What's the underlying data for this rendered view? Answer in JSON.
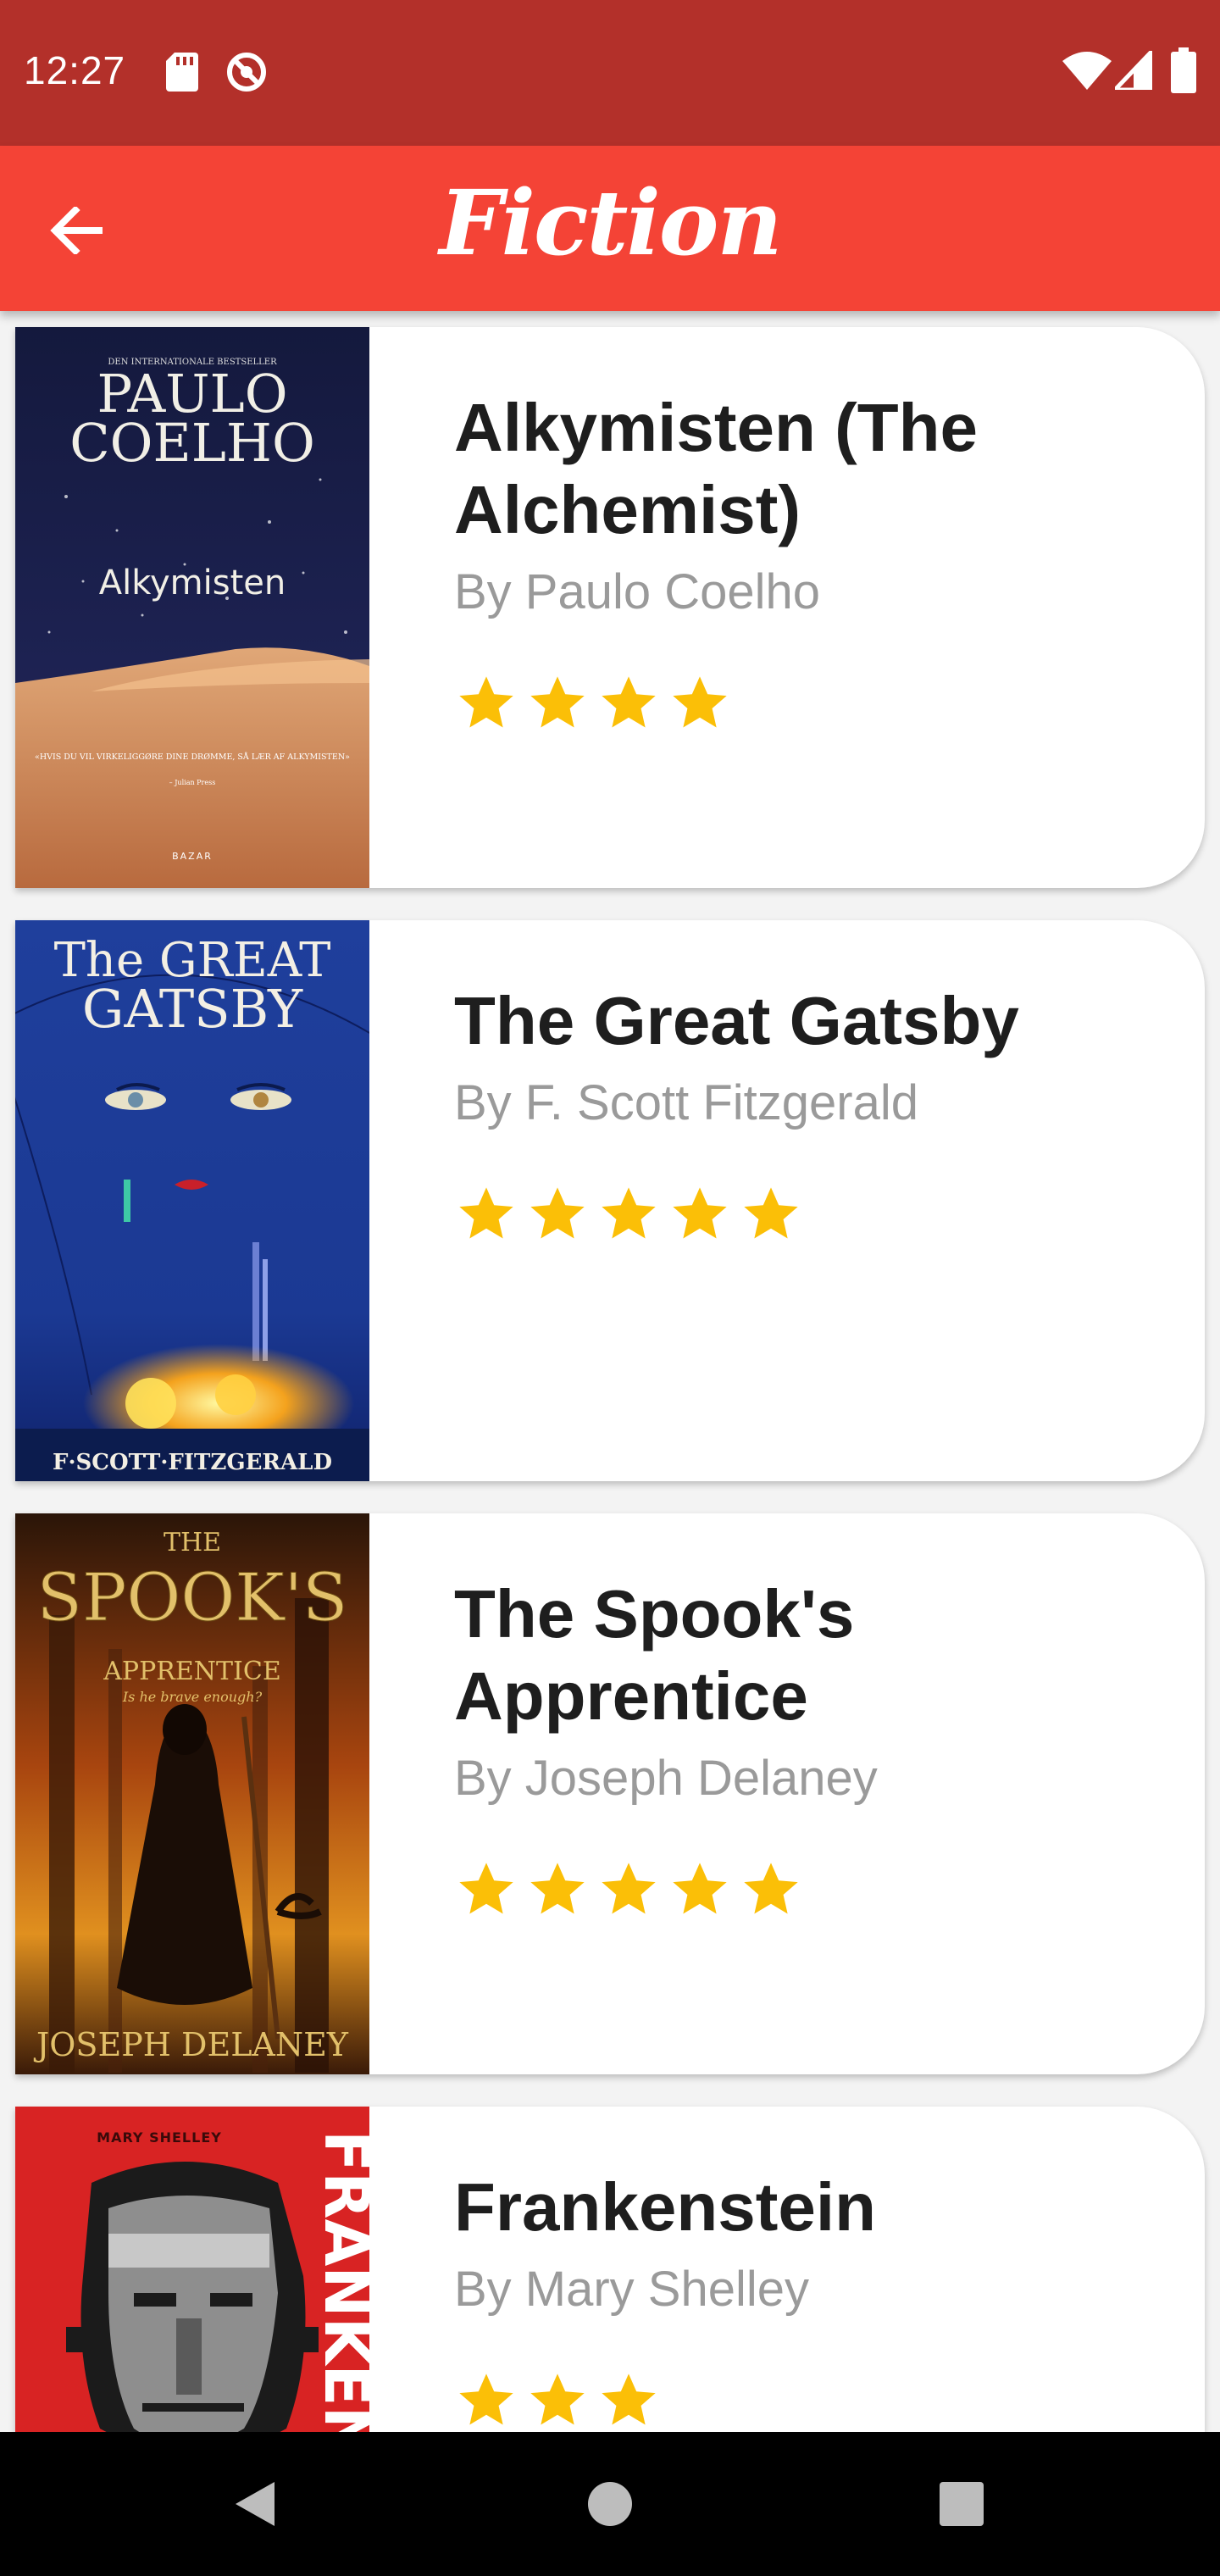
{
  "status_bar": {
    "time": "12:27",
    "icons_left": [
      "sd-card-icon",
      "do-not-disturb-icon"
    ],
    "icons_right": [
      "wifi-icon",
      "signal-icon",
      "battery-icon"
    ]
  },
  "app_bar": {
    "title": "Fiction",
    "back_icon": "arrow-back-icon"
  },
  "books": [
    {
      "title": "Alkymisten (The Alchemist)",
      "author": "By Paulo Coelho",
      "rating": 4,
      "cover": {
        "top": "DEN INTERNATIONALE BESTSELLER",
        "author_line1": "PAULO",
        "author_line2": "COELHO",
        "title": "Alkymisten",
        "quote": "«HVIS DU VIL VIRKELIGGØRE DINE DRØMME, SÅ LÆR AF ALKYMISTEN»",
        "quote_by": "– Julian Press",
        "publisher": "BAZAR"
      }
    },
    {
      "title": "The Great Gatsby",
      "author": "By F. Scott Fitzgerald",
      "rating": 5,
      "cover": {
        "title_line1": "The GREAT",
        "title_line2": "GATSBY",
        "author": "F·SCOTT·FITZGERALD"
      }
    },
    {
      "title": "The Spook's Apprentice",
      "author": "By Joseph Delaney",
      "rating": 5,
      "cover": {
        "the": "THE",
        "title": "SPOOK'S",
        "subtitle": "APPRENTICE",
        "tagline": "Is he brave enough?",
        "author": "JOSEPH DELANEY"
      }
    },
    {
      "title": "Frankenstein",
      "author": "By Mary Shelley",
      "rating": 3,
      "cover": {
        "author": "MARY SHELLEY",
        "title": "FRANKENSTEIN"
      }
    }
  ],
  "colors": {
    "status_bar": "#b3302a",
    "app_bar": "#f44336",
    "star": "#fbbf07",
    "background": "#f3f3f3"
  },
  "nav_bar": {
    "icons": [
      "back-triangle-icon",
      "home-circle-icon",
      "recents-square-icon"
    ]
  }
}
